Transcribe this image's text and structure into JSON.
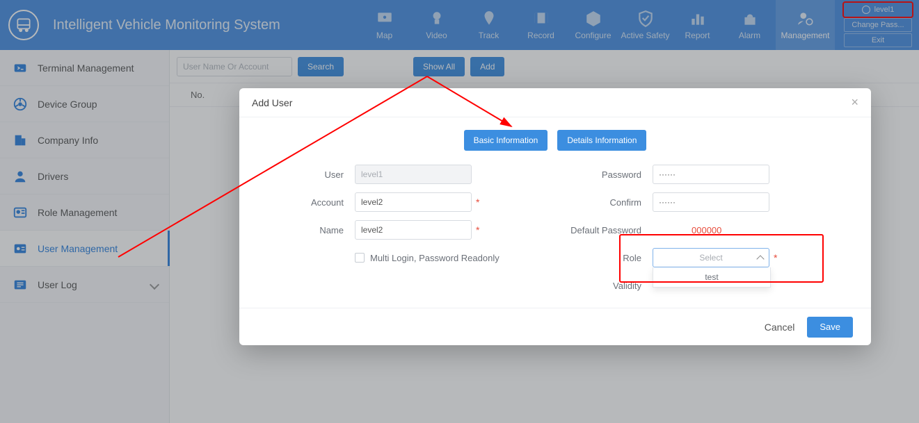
{
  "app": {
    "title": "Intelligent Vehicle Monitoring System"
  },
  "nav": {
    "items": [
      {
        "label": "Map"
      },
      {
        "label": "Video"
      },
      {
        "label": "Track"
      },
      {
        "label": "Record"
      },
      {
        "label": "Configure"
      },
      {
        "label": "Active Safety"
      },
      {
        "label": "Report"
      },
      {
        "label": "Alarm"
      },
      {
        "label": "Management"
      }
    ],
    "active_index": 8
  },
  "user_header": {
    "name": "level1",
    "change_pass": "Change Pass...",
    "exit": "Exit"
  },
  "sidebar": {
    "items": [
      {
        "label": "Terminal Management"
      },
      {
        "label": "Device Group"
      },
      {
        "label": "Company Info"
      },
      {
        "label": "Drivers"
      },
      {
        "label": "Role Management"
      },
      {
        "label": "User Management"
      },
      {
        "label": "User Log"
      }
    ],
    "active_index": 5
  },
  "toolbar": {
    "search_placeholder": "User Name Or Account",
    "search_btn": "Search",
    "show_all_btn": "Show All",
    "add_btn": "Add"
  },
  "table": {
    "col_no": "No."
  },
  "modal": {
    "title": "Add User",
    "tabs": {
      "basic": "Basic Information",
      "details": "Details Information"
    },
    "labels": {
      "user": "User",
      "account": "Account",
      "name": "Name",
      "password": "Password",
      "confirm": "Confirm",
      "default_password": "Default Password",
      "role": "Role",
      "validity": "Validity"
    },
    "values": {
      "user": "level1",
      "account": "level2",
      "name": "level2",
      "password": "······",
      "confirm": "······",
      "default_password": "000000",
      "role_placeholder": "Select",
      "role_option_1": "test"
    },
    "multi_login_label": "Multi Login, Password Readonly",
    "footer": {
      "cancel": "Cancel",
      "save": "Save"
    }
  }
}
